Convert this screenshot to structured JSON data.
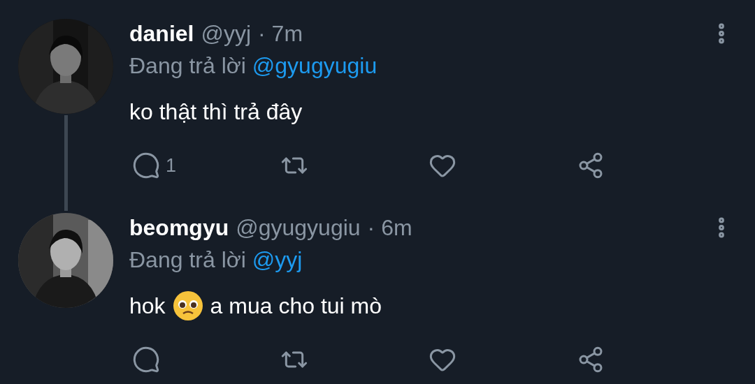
{
  "tweets": [
    {
      "name": "daniel",
      "handle": "@yyj",
      "time": "· 7m",
      "reply_prefix": "Đang trả lời",
      "reply_to": "@gyugyugiu",
      "body": [
        {
          "kind": "text",
          "text": "ko thật thì trả đây"
        }
      ],
      "reply_count": "1",
      "thread_continues": true
    },
    {
      "name": "beomgyu",
      "handle": "@gyugyugiu",
      "time": "· 6m",
      "reply_prefix": "Đang trả lời",
      "reply_to": "@yyj",
      "body": [
        {
          "kind": "text",
          "text": "hok"
        },
        {
          "kind": "emoji"
        },
        {
          "kind": "text",
          "text": "a mua cho tui mò"
        }
      ],
      "thread_continues": false
    }
  ]
}
